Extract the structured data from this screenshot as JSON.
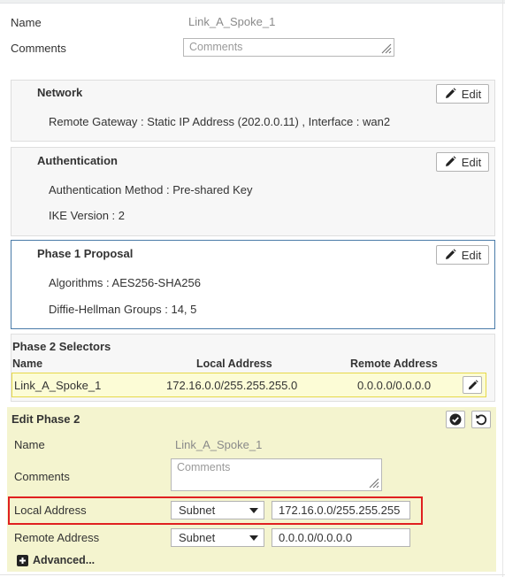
{
  "form": {
    "name_label": "Name",
    "name_value": "Link_A_Spoke_1",
    "comments_label": "Comments",
    "comments_placeholder": "Comments"
  },
  "panels": {
    "network": {
      "title": "Network",
      "edit_label": "Edit",
      "line1": "Remote Gateway : Static IP Address (202.0.0.11) , Interface : wan2"
    },
    "authentication": {
      "title": "Authentication",
      "edit_label": "Edit",
      "line1": "Authentication Method : Pre-shared Key",
      "line2": "IKE Version : 2"
    },
    "phase1": {
      "title": "Phase 1 Proposal",
      "edit_label": "Edit",
      "line1": "Algorithms : AES256-SHA256",
      "line2": "Diffie-Hellman Groups : 14, 5"
    }
  },
  "phase2_selectors": {
    "title": "Phase 2 Selectors",
    "columns": [
      "Name",
      "Local Address",
      "Remote Address"
    ],
    "rows": [
      {
        "name": "Link_A_Spoke_1",
        "local": "172.16.0.0/255.255.255.0",
        "remote": "0.0.0.0/0.0.0.0"
      }
    ]
  },
  "edit_phase2": {
    "title": "Edit Phase 2",
    "name_label": "Name",
    "name_value": "Link_A_Spoke_1",
    "comments_label": "Comments",
    "comments_placeholder": "Comments",
    "local_label": "Local Address",
    "local_type": "Subnet",
    "local_value": "172.16.0.0/255.255.255",
    "remote_label": "Remote Address",
    "remote_type": "Subnet",
    "remote_value": "0.0.0.0/0.0.0.0",
    "advanced_label": "Advanced..."
  },
  "icons": {
    "edit": "pencil-icon",
    "confirm": "check-circle-icon",
    "revert": "undo-icon",
    "expand": "plus-square-icon"
  },
  "colors": {
    "active_border": "#4a7ba8",
    "highlight_row": "#fcfcd6",
    "phase2_bg": "#f4f4cf",
    "error_outline": "#e02020"
  }
}
